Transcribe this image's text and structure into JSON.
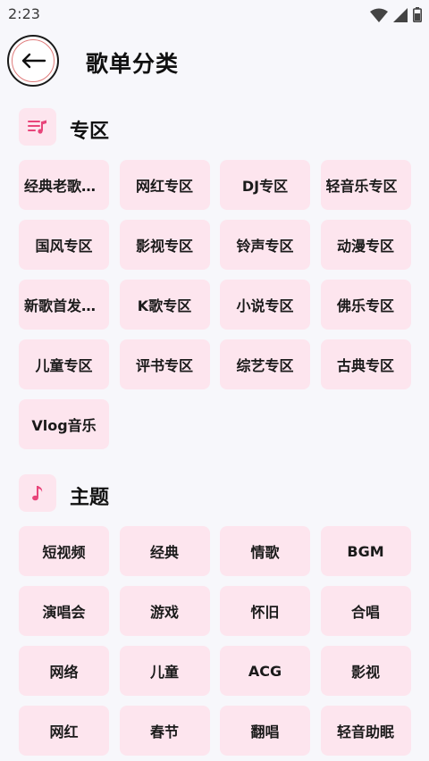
{
  "status_bar": {
    "time": "2:23"
  },
  "header": {
    "title": "歌单分类"
  },
  "sections": [
    {
      "title": "专区",
      "icon": "playlist-music-icon",
      "items": [
        "经典老歌专区",
        "网红专区",
        "DJ专区",
        "轻音乐专区",
        "国风专区",
        "影视专区",
        "铃声专区",
        "动漫专区",
        "新歌首发专区",
        "K歌专区",
        "小说专区",
        "佛乐专区",
        "儿童专区",
        "评书专区",
        "综艺专区",
        "古典专区",
        "Vlog音乐"
      ]
    },
    {
      "title": "主题",
      "icon": "music-note-icon",
      "items": [
        "短视频",
        "经典",
        "情歌",
        "BGM",
        "演唱会",
        "游戏",
        "怀旧",
        "合唱",
        "网络",
        "儿童",
        "ACG",
        "影视",
        "网红",
        "春节",
        "翻唱",
        "轻音助眠"
      ]
    }
  ],
  "colors": {
    "chip_bg": "#fde5ee",
    "accent": "#e8457a",
    "page_bg": "#f7f7fb"
  }
}
